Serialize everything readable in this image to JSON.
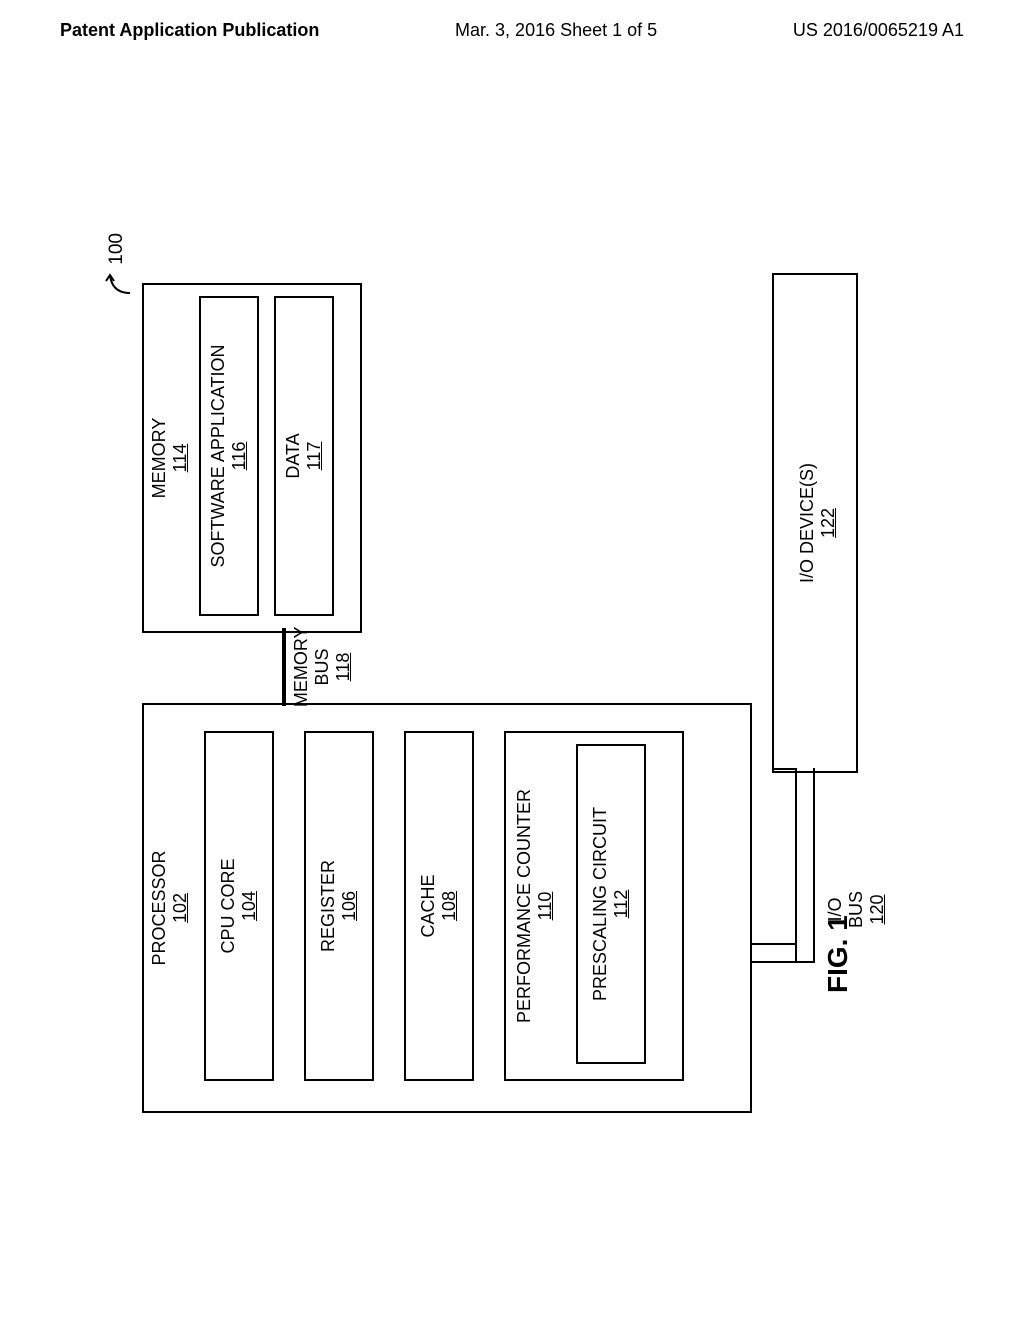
{
  "header": {
    "left": "Patent Application Publication",
    "center": "Mar. 3, 2016  Sheet 1 of 5",
    "right": "US 2016/0065219 A1"
  },
  "ref_num": "100",
  "fig_label": "FIG. 1",
  "processor": {
    "label": "PROCESSOR",
    "num": "102"
  },
  "cpu_core": {
    "label": "CPU CORE",
    "num": "104"
  },
  "register": {
    "label": "REGISTER",
    "num": "106"
  },
  "cache": {
    "label": "CACHE",
    "num": "108"
  },
  "perf_counter": {
    "label": "PERFORMANCE COUNTER",
    "num": "110"
  },
  "prescaling": {
    "label": "PRESCALING CIRCUIT",
    "num": "112"
  },
  "memory": {
    "label": "MEMORY",
    "num": "114"
  },
  "software": {
    "label": "SOFTWARE APPLICATION",
    "num": "116"
  },
  "data": {
    "label": "DATA",
    "num": "117"
  },
  "memory_bus": {
    "label": "MEMORY BUS",
    "num": "118"
  },
  "io_bus": {
    "label": "I/O BUS",
    "num": "120"
  },
  "io_device": {
    "label": "I/O DEVICE(S)",
    "num": "122"
  }
}
